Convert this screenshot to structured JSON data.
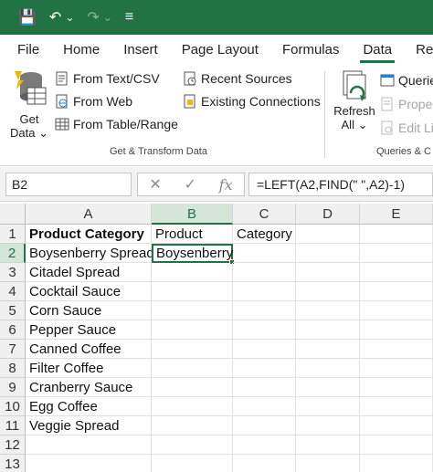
{
  "quick_access": {
    "items": [
      {
        "name": "save-icon",
        "glyph": "💾"
      },
      {
        "name": "undo-icon",
        "glyph": "↶"
      },
      {
        "name": "undo-dropdown-icon",
        "glyph": "⌄"
      },
      {
        "name": "redo-icon",
        "glyph": "↷"
      },
      {
        "name": "redo-dropdown-icon",
        "glyph": "⌄"
      },
      {
        "name": "customize-toolbar-icon",
        "glyph": "≡"
      }
    ]
  },
  "tabs": [
    "File",
    "Home",
    "Insert",
    "Page Layout",
    "Formulas",
    "Data",
    "Revi"
  ],
  "active_tab": "Data",
  "ribbon": {
    "get_data": {
      "line1": "Get",
      "line2": "Data ⌄"
    },
    "from_text_csv": "From Text/CSV",
    "from_web": "From Web",
    "from_table_range": "From Table/Range",
    "recent_sources": "Recent Sources",
    "existing_connections": "Existing Connections",
    "group_get_transform": "Get & Transform Data",
    "refresh": {
      "line1": "Refresh",
      "line2": "All ⌄"
    },
    "queries": "Querie",
    "properties": "Proper",
    "edit_links": "Edit Lin",
    "group_queries": "Queries & C"
  },
  "formula_bar": {
    "name_box": "B2",
    "cancel_glyph": "✕",
    "enter_glyph": "✓",
    "fx_glyph": "fx",
    "formula": "=LEFT(A2,FIND(\" \",A2)-1)"
  },
  "grid": {
    "columns": [
      "A",
      "B",
      "C",
      "D",
      "E"
    ],
    "selected_column": "B",
    "selected_row": 2,
    "rows": [
      {
        "num": "1",
        "A": "Product Category",
        "B": "Product",
        "C": "Category"
      },
      {
        "num": "2",
        "A": "Boysenberry Spread",
        "B": "Boysenberry",
        "C": ""
      },
      {
        "num": "3",
        "A": "Citadel Spread",
        "B": "",
        "C": ""
      },
      {
        "num": "4",
        "A": "Cocktail Sauce",
        "B": "",
        "C": ""
      },
      {
        "num": "5",
        "A": "Corn Sauce",
        "B": "",
        "C": ""
      },
      {
        "num": "6",
        "A": "Pepper Sauce",
        "B": "",
        "C": ""
      },
      {
        "num": "7",
        "A": "Canned Coffee",
        "B": "",
        "C": ""
      },
      {
        "num": "8",
        "A": "Filter Coffee",
        "B": "",
        "C": ""
      },
      {
        "num": "9",
        "A": "Cranberry Sauce",
        "B": "",
        "C": ""
      },
      {
        "num": "10",
        "A": "Egg Coffee",
        "B": "",
        "C": ""
      },
      {
        "num": "11",
        "A": "Veggie Spread",
        "B": "",
        "C": ""
      },
      {
        "num": "12",
        "A": "",
        "B": "",
        "C": ""
      },
      {
        "num": "13",
        "A": "",
        "B": "",
        "C": ""
      }
    ]
  },
  "colors": {
    "accent": "#217346"
  }
}
